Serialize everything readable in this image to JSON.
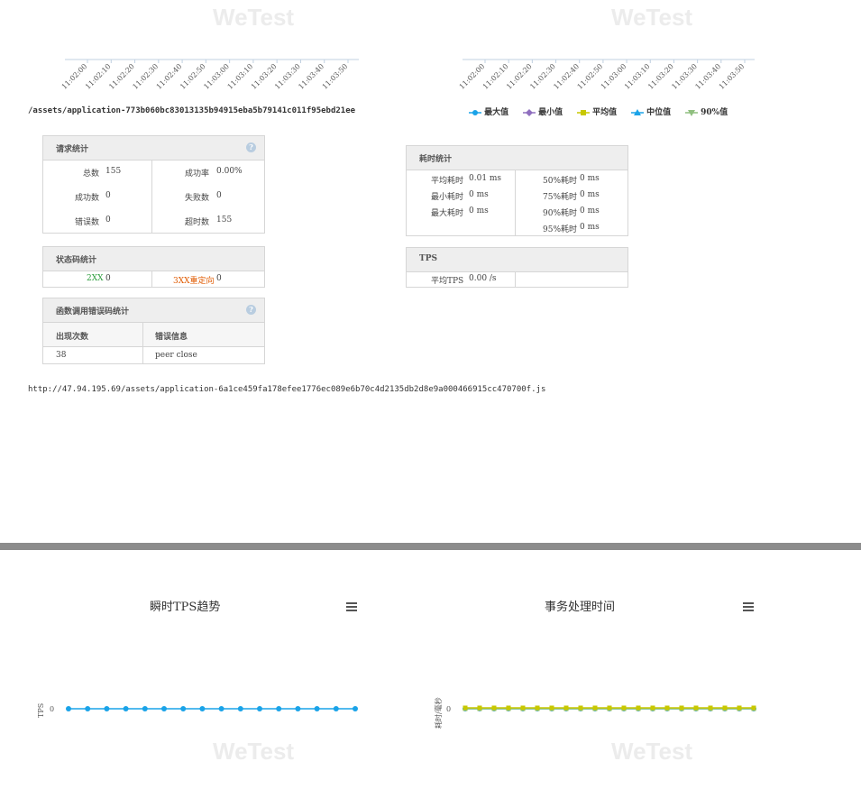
{
  "watermark": "WeTest",
  "top_chart_left": {
    "x_ticks": [
      "11:02:00",
      "11:02:10",
      "11:02:20",
      "11:02:30",
      "11:02:40",
      "11:02:50",
      "11:03:00",
      "11:03:10",
      "11:03:20",
      "11:03:30",
      "11:03:40",
      "11:03:50"
    ]
  },
  "top_chart_right": {
    "x_ticks": [
      "11:02:00",
      "11:02:10",
      "11:02:20",
      "11:02:30",
      "11:02:40",
      "11:02:50",
      "11:03:00",
      "11:03:10",
      "11:03:20",
      "11:03:30",
      "11:03:40",
      "11:03:50"
    ],
    "legend": [
      {
        "name": "最大值",
        "color": "#1aa3e8",
        "marker": "circle"
      },
      {
        "name": "最小值",
        "color": "#8f6fbf",
        "marker": "diamond"
      },
      {
        "name": "平均值",
        "color": "#c8c800",
        "marker": "square"
      },
      {
        "name": "中位值",
        "color": "#1aa3e8",
        "marker": "triangle"
      },
      {
        "name": "90%值",
        "color": "#8fbf7f",
        "marker": "triangle-down"
      }
    ]
  },
  "asset_url_1": "/assets/application-773b060bc83013135b94915eba5b79141c011f95ebd21ee",
  "request_stats": {
    "title": "请求统计",
    "help": "?",
    "total_label": "总数",
    "total_value": "155",
    "success_rate_label": "成功率",
    "success_rate_value": "0.00%",
    "success_label": "成功数",
    "success_value": "0",
    "fail_label": "失败数",
    "fail_value": "0",
    "error_label": "错误数",
    "error_value": "0",
    "timeout_label": "超时数",
    "timeout_value": "155"
  },
  "status_stats": {
    "title": "状态码统计",
    "c2xx_label": "2XX",
    "c2xx_value": "0",
    "c3xx_label": "3XX重定向",
    "c3xx_value": "0",
    "c2xx_color": "#2e9e3e",
    "c3xx_color": "#e05a00"
  },
  "error_stats": {
    "title": "函数调用错误码统计",
    "help": "?",
    "col_count": "出现次数",
    "col_info": "错误信息",
    "rows": [
      {
        "count": "38",
        "info": "peer close"
      }
    ]
  },
  "time_stats": {
    "title": "耗时统计",
    "avg_label": "平均耗时",
    "avg_value": "0.01 ms",
    "min_label": "最小耗时",
    "min_value": "0 ms",
    "max_label": "最大耗时",
    "max_value": "0 ms",
    "p50_label": "50%耗时",
    "p50_value": "0 ms",
    "p75_label": "75%耗时",
    "p75_value": "0 ms",
    "p90_label": "90%耗时",
    "p90_value": "0 ms",
    "p95_label": "95%耗时",
    "p95_value": "0 ms"
  },
  "tps_stats": {
    "title": "TPS",
    "avg_label": "平均TPS",
    "avg_value": "0.00 /s"
  },
  "asset_url_2": "http://47.94.195.69/assets/application-6a1ce459fa178efee1776ec089e6b70c4d2135db2d8e9a000466915cc470700f.js",
  "chart_data": [
    {
      "type": "line",
      "title": "瞬时TPS趋势",
      "ylabel": "TPS",
      "y_ticks": [
        "0"
      ],
      "series": [
        {
          "values": [
            0,
            0,
            0,
            0,
            0,
            0,
            0,
            0,
            0,
            0,
            0,
            0,
            0,
            0,
            0,
            0
          ],
          "color": "#1aa3e8"
        }
      ]
    },
    {
      "type": "line",
      "title": "事务处理时间",
      "ylabel": "耗时/毫秒",
      "y_ticks": [
        "0"
      ],
      "series": [
        {
          "values": [
            0,
            0,
            0,
            0,
            0,
            0,
            0,
            0,
            0,
            0,
            0,
            0,
            0,
            0,
            0,
            0,
            0,
            0,
            0,
            0,
            0
          ],
          "color": "#1aa3e8"
        },
        {
          "values": [
            0,
            0,
            0,
            0,
            0,
            0,
            0,
            0,
            0,
            0,
            0,
            0,
            0,
            0,
            0,
            0,
            0,
            0,
            0,
            0,
            0
          ],
          "color": "#8fbf7f"
        },
        {
          "values": [
            0,
            0,
            0,
            0,
            0,
            0,
            0,
            0,
            0,
            0,
            0,
            0,
            0,
            0,
            0,
            0,
            0,
            0,
            0,
            0,
            0
          ],
          "color": "#c8c800"
        }
      ]
    }
  ]
}
